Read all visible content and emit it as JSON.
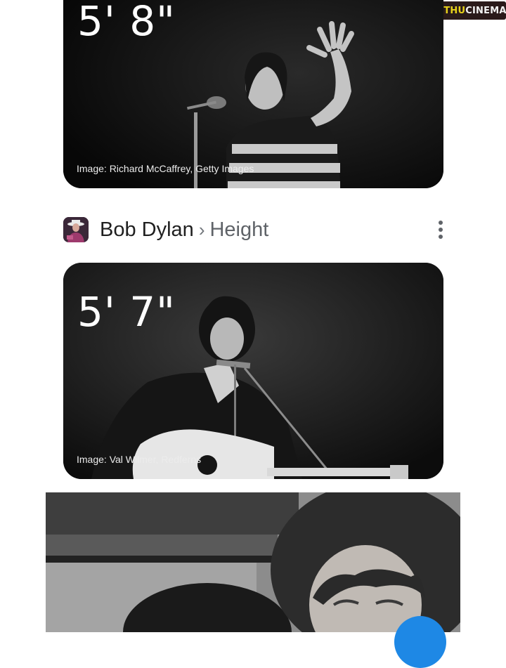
{
  "watermark": {
    "part1": "GETHU",
    "part2": "CINEMA"
  },
  "cards": {
    "first": {
      "height": "5' 8\"",
      "credit": "Image: Richard McCaffrey, Getty Images"
    },
    "dylan": {
      "height": "5' 7\"",
      "credit": "Image: Val Wilmer, Redferns"
    }
  },
  "result_header": {
    "name": "Bob Dylan",
    "separator": "›",
    "topic": "Height"
  },
  "icons": {
    "more": "more-vert-icon"
  },
  "colors": {
    "card_bg": "#111111",
    "fab": "#1e88e5"
  }
}
